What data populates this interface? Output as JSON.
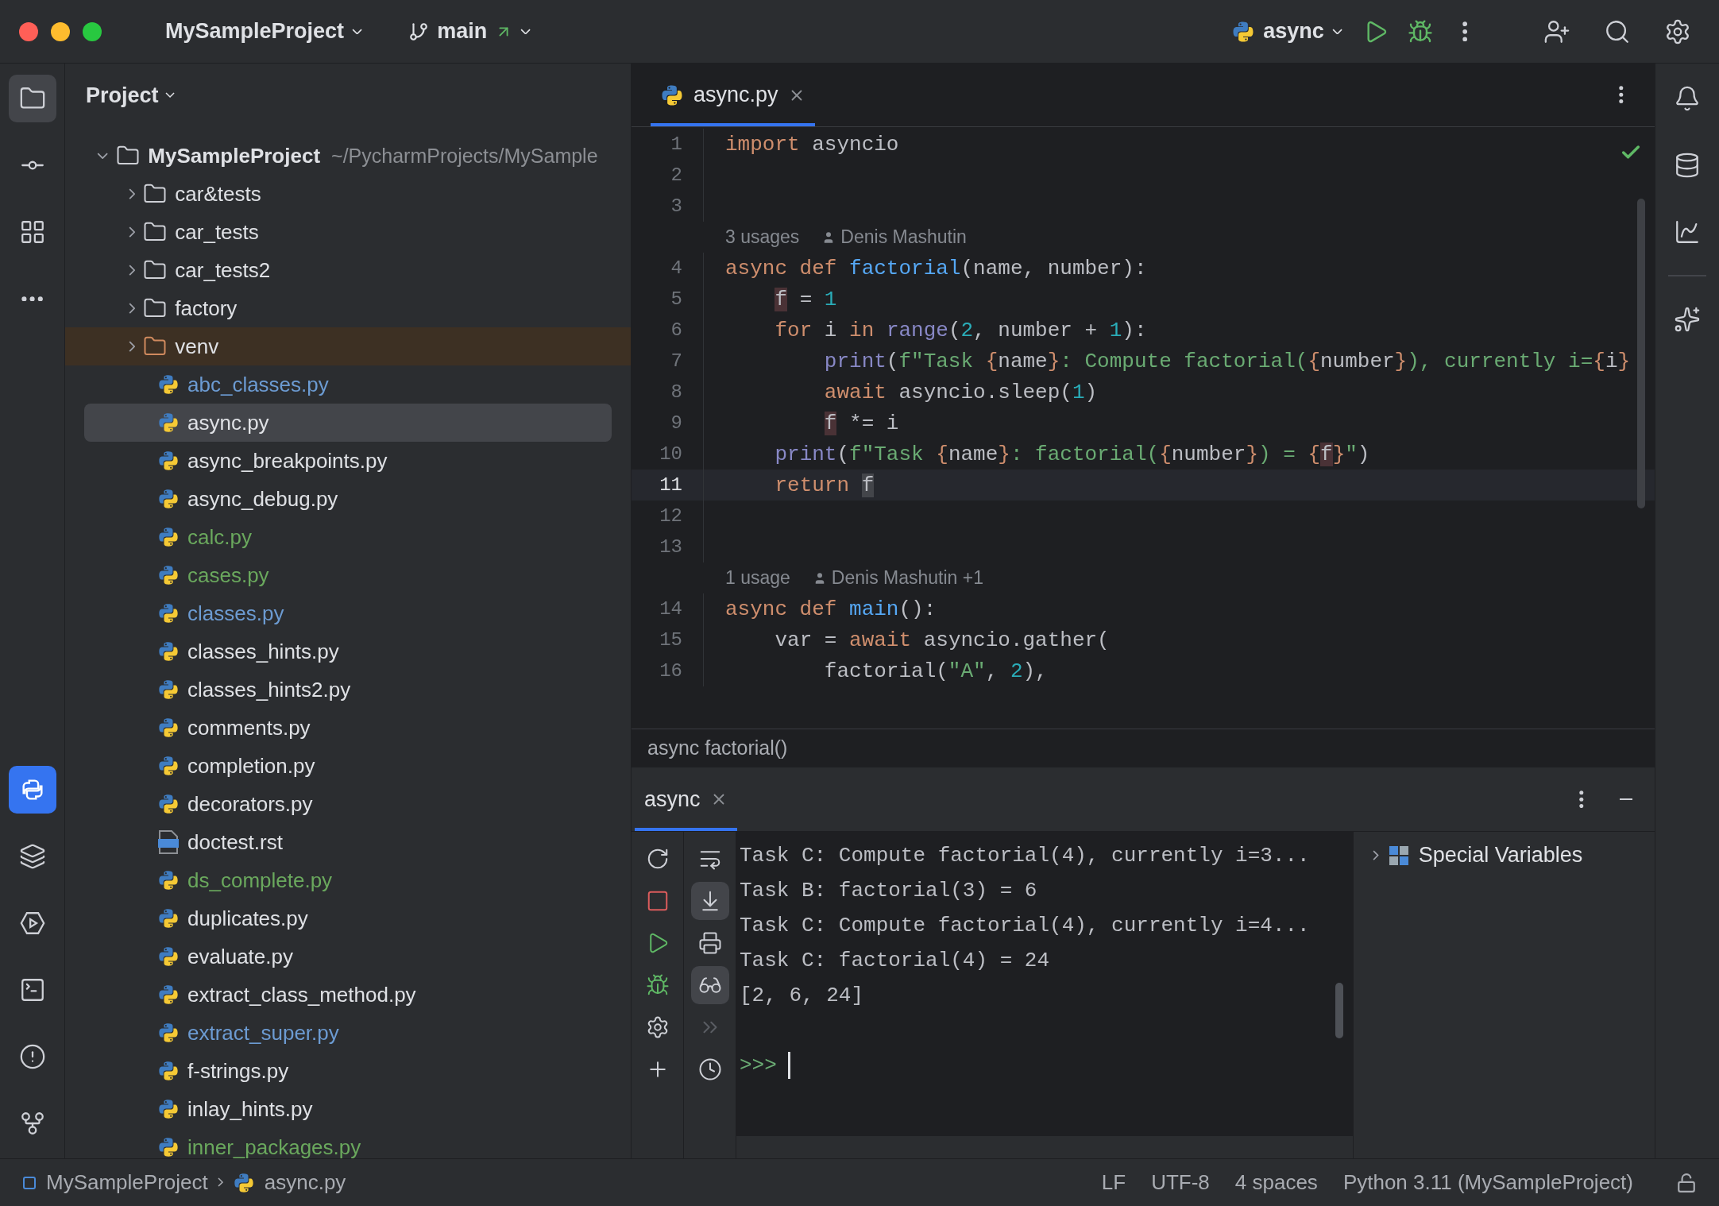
{
  "title_bar": {
    "project": "MySampleProject",
    "branch": "main",
    "run_config": "async"
  },
  "left_strip": {
    "top": [
      {
        "kind": "project",
        "selected": true
      },
      {
        "kind": "commit",
        "selected": false
      },
      {
        "kind": "structure",
        "selected": false
      },
      {
        "kind": "more",
        "selected": false
      }
    ],
    "bottom": [
      {
        "kind": "python-console",
        "selected": true
      },
      {
        "kind": "layers",
        "selected": false
      },
      {
        "kind": "services",
        "selected": false
      },
      {
        "kind": "terminal",
        "selected": false
      },
      {
        "kind": "problems",
        "selected": false
      },
      {
        "kind": "git",
        "selected": false
      }
    ]
  },
  "project_panel": {
    "title": "Project",
    "tree": [
      {
        "kind": "folder",
        "name": "MySampleProject",
        "path": "~/PycharmProjects/MySample",
        "expanded": true,
        "selected": false,
        "children": [
          {
            "kind": "folder",
            "name": "car&tests",
            "expanded": false,
            "selected": false
          },
          {
            "kind": "folder",
            "name": "car_tests",
            "expanded": false,
            "selected": false
          },
          {
            "kind": "folder",
            "name": "car_tests2",
            "expanded": false,
            "selected": false
          },
          {
            "kind": "folder",
            "name": "factory",
            "expanded": false,
            "selected": false
          },
          {
            "kind": "excluded-folder",
            "name": "venv",
            "expanded": false,
            "selected": false
          },
          {
            "kind": "python",
            "name": "abc_classes.py",
            "color": "#6c9bd2",
            "selected": false
          },
          {
            "kind": "python",
            "name": "async.py",
            "color": "#dfe1e5",
            "selected": true
          },
          {
            "kind": "python",
            "name": "async_breakpoints.py",
            "color": "#dfe1e5",
            "selected": false
          },
          {
            "kind": "python",
            "name": "async_debug.py",
            "color": "#dfe1e5",
            "selected": false
          },
          {
            "kind": "python",
            "name": "calc.py",
            "color": "#6aa85d",
            "selected": false
          },
          {
            "kind": "python",
            "name": "cases.py",
            "color": "#6aa85d",
            "selected": false
          },
          {
            "kind": "python",
            "name": "classes.py",
            "color": "#6c9bd2",
            "selected": false
          },
          {
            "kind": "python",
            "name": "classes_hints.py",
            "color": "#dfe1e5",
            "selected": false
          },
          {
            "kind": "python",
            "name": "classes_hints2.py",
            "color": "#dfe1e5",
            "selected": false
          },
          {
            "kind": "python",
            "name": "comments.py",
            "color": "#dfe1e5",
            "selected": false
          },
          {
            "kind": "python",
            "name": "completion.py",
            "color": "#dfe1e5",
            "selected": false
          },
          {
            "kind": "python",
            "name": "decorators.py",
            "color": "#dfe1e5",
            "selected": false
          },
          {
            "kind": "rst",
            "name": "doctest.rst",
            "color": "#dfe1e5",
            "selected": false
          },
          {
            "kind": "python",
            "name": "ds_complete.py",
            "color": "#6aa85d",
            "selected": false
          },
          {
            "kind": "python",
            "name": "duplicates.py",
            "color": "#dfe1e5",
            "selected": false
          },
          {
            "kind": "python",
            "name": "evaluate.py",
            "color": "#dfe1e5",
            "selected": false
          },
          {
            "kind": "python",
            "name": "extract_class_method.py",
            "color": "#dfe1e5",
            "selected": false
          },
          {
            "kind": "python",
            "name": "extract_super.py",
            "color": "#6c9bd2",
            "selected": false
          },
          {
            "kind": "python",
            "name": "f-strings.py",
            "color": "#dfe1e5",
            "selected": false
          },
          {
            "kind": "python",
            "name": "inlay_hints.py",
            "color": "#dfe1e5",
            "selected": false
          },
          {
            "kind": "python",
            "name": "inner_packages.py",
            "color": "#6aa85d",
            "selected": false
          }
        ]
      }
    ]
  },
  "editor": {
    "tabs": [
      {
        "label": "async.py",
        "selected": true
      }
    ],
    "lines": [
      {
        "kind": "code",
        "number": "1",
        "current": false,
        "tokens": [
          {
            "kind": "kw",
            "text": "import "
          },
          {
            "kind": "plain",
            "text": "asyncio"
          }
        ]
      },
      {
        "kind": "code",
        "number": "2",
        "current": false
      },
      {
        "kind": "code",
        "number": "3",
        "current": false
      },
      {
        "kind": "hint",
        "usages": "3 usages",
        "author": "Denis Mashutin"
      },
      {
        "kind": "code",
        "number": "4",
        "current": false,
        "tokens": [
          {
            "kind": "kw",
            "text": "async def "
          },
          {
            "kind": "fn",
            "text": "factorial"
          },
          {
            "kind": "plain",
            "text": "(name, number):"
          }
        ]
      },
      {
        "kind": "code",
        "number": "5",
        "current": false,
        "tokens": [
          {
            "kind": "ref",
            "text": "    f"
          },
          {
            "kind": "plain",
            "text": " = "
          },
          {
            "kind": "num",
            "text": "1"
          }
        ]
      },
      {
        "kind": "code",
        "number": "6",
        "current": false,
        "tokens": [
          {
            "kind": "kw",
            "text": "    for "
          },
          {
            "kind": "plain",
            "text": "i "
          },
          {
            "kind": "kw",
            "text": "in "
          },
          {
            "kind": "builtin",
            "text": "range"
          },
          {
            "kind": "plain",
            "text": "("
          },
          {
            "kind": "num",
            "text": "2"
          },
          {
            "kind": "plain",
            "text": ", number + "
          },
          {
            "kind": "num",
            "text": "1"
          },
          {
            "kind": "plain",
            "text": "):"
          }
        ]
      },
      {
        "kind": "code",
        "number": "7",
        "current": false,
        "tokens": [
          {
            "kind": "builtin",
            "text": "        print"
          },
          {
            "kind": "plain",
            "text": "("
          },
          {
            "kind": "str",
            "text": "f\"Task "
          },
          {
            "kind": "brace",
            "text": "{"
          },
          {
            "kind": "plain",
            "text": "name"
          },
          {
            "kind": "brace",
            "text": "}"
          },
          {
            "kind": "str",
            "text": ": Compute factorial("
          },
          {
            "kind": "brace",
            "text": "{"
          },
          {
            "kind": "plain",
            "text": "number"
          },
          {
            "kind": "brace",
            "text": "}"
          },
          {
            "kind": "str",
            "text": "), currently i="
          },
          {
            "kind": "brace",
            "text": "{"
          },
          {
            "kind": "plain",
            "text": "i"
          },
          {
            "kind": "brace",
            "text": "}"
          }
        ]
      },
      {
        "kind": "code",
        "number": "8",
        "current": false,
        "tokens": [
          {
            "kind": "kw",
            "text": "        await "
          },
          {
            "kind": "plain",
            "text": "asyncio.sleep("
          },
          {
            "kind": "num",
            "text": "1"
          },
          {
            "kind": "plain",
            "text": ")"
          }
        ]
      },
      {
        "kind": "code",
        "number": "9",
        "current": false,
        "tokens": [
          {
            "kind": "ref",
            "text": "        f"
          },
          {
            "kind": "plain",
            "text": " *= i"
          }
        ]
      },
      {
        "kind": "code",
        "number": "10",
        "current": false,
        "tokens": [
          {
            "kind": "builtin",
            "text": "    print"
          },
          {
            "kind": "plain",
            "text": "("
          },
          {
            "kind": "str",
            "text": "f\"Task "
          },
          {
            "kind": "brace",
            "text": "{"
          },
          {
            "kind": "plain",
            "text": "name"
          },
          {
            "kind": "brace",
            "text": "}"
          },
          {
            "kind": "str",
            "text": ": factorial("
          },
          {
            "kind": "brace",
            "text": "{"
          },
          {
            "kind": "plain",
            "text": "number"
          },
          {
            "kind": "brace",
            "text": "}"
          },
          {
            "kind": "str",
            "text": ") = "
          },
          {
            "kind": "brace",
            "text": "{"
          },
          {
            "kind": "ref",
            "text": "f"
          },
          {
            "kind": "brace",
            "text": "}"
          },
          {
            "kind": "str",
            "text": "\""
          },
          {
            "kind": "plain",
            "text": ")"
          }
        ]
      },
      {
        "kind": "code",
        "number": "11",
        "current": true,
        "tokens": [
          {
            "kind": "kw",
            "text": "    return "
          },
          {
            "kind": "cur",
            "text": "f"
          }
        ]
      },
      {
        "kind": "code",
        "number": "12",
        "current": false
      },
      {
        "kind": "code",
        "number": "13",
        "current": false
      },
      {
        "kind": "hint",
        "usages": "1 usage",
        "author": "Denis Mashutin +1"
      },
      {
        "kind": "code",
        "number": "14",
        "current": false,
        "tokens": [
          {
            "kind": "kw",
            "text": "async def "
          },
          {
            "kind": "fn",
            "text": "main"
          },
          {
            "kind": "plain",
            "text": "():"
          }
        ]
      },
      {
        "kind": "code",
        "number": "15",
        "current": false,
        "tokens": [
          {
            "kind": "plain",
            "text": "    var = "
          },
          {
            "kind": "kw",
            "text": "await "
          },
          {
            "kind": "plain",
            "text": "asyncio.gather("
          }
        ]
      },
      {
        "kind": "code",
        "number": "16",
        "current": false,
        "tokens": [
          {
            "kind": "plain",
            "text": "        factorial("
          },
          {
            "kind": "str",
            "text": "\"A\""
          },
          {
            "kind": "plain",
            "text": ", "
          },
          {
            "kind": "num",
            "text": "2"
          },
          {
            "kind": "plain",
            "text": "),"
          }
        ]
      }
    ],
    "breadcrumb": "async factorial()"
  },
  "right_strip": [
    {
      "kind": "notifications"
    },
    {
      "kind": "database"
    },
    {
      "kind": "chart"
    },
    {
      "kind": "ai"
    }
  ],
  "console": {
    "tabs": [
      {
        "label": "async",
        "selected": true
      }
    ],
    "run_tools": [
      {
        "kind": "rerun"
      },
      {
        "kind": "stop"
      },
      {
        "kind": "run"
      },
      {
        "kind": "debug"
      },
      {
        "kind": "settings"
      },
      {
        "kind": "add"
      }
    ],
    "view_tools": [
      {
        "kind": "soft-wrap",
        "selected": false,
        "disabled": false
      },
      {
        "kind": "scroll-end",
        "selected": true,
        "disabled": false
      },
      {
        "kind": "print",
        "selected": false,
        "disabled": false
      },
      {
        "kind": "variables",
        "selected": true,
        "disabled": false
      },
      {
        "kind": "execute",
        "selected": false,
        "disabled": true
      },
      {
        "kind": "history",
        "selected": false,
        "disabled": false
      }
    ],
    "output": [
      "Task C: Compute factorial(4), currently i=3...",
      "Task B: factorial(3) = 6",
      "Task C: Compute factorial(4), currently i=4...",
      "Task C: factorial(4) = 24",
      "[2, 6, 24]"
    ],
    "prompt": ">>>",
    "variables": [
      {
        "label": "Special Variables",
        "expanded": false
      }
    ]
  },
  "status_bar": {
    "breadcrumbs": [
      "MySampleProject",
      "async.py"
    ],
    "items": [
      "LF",
      "UTF-8",
      "4 spaces",
      "Python 3.11 (MySampleProject)"
    ]
  }
}
